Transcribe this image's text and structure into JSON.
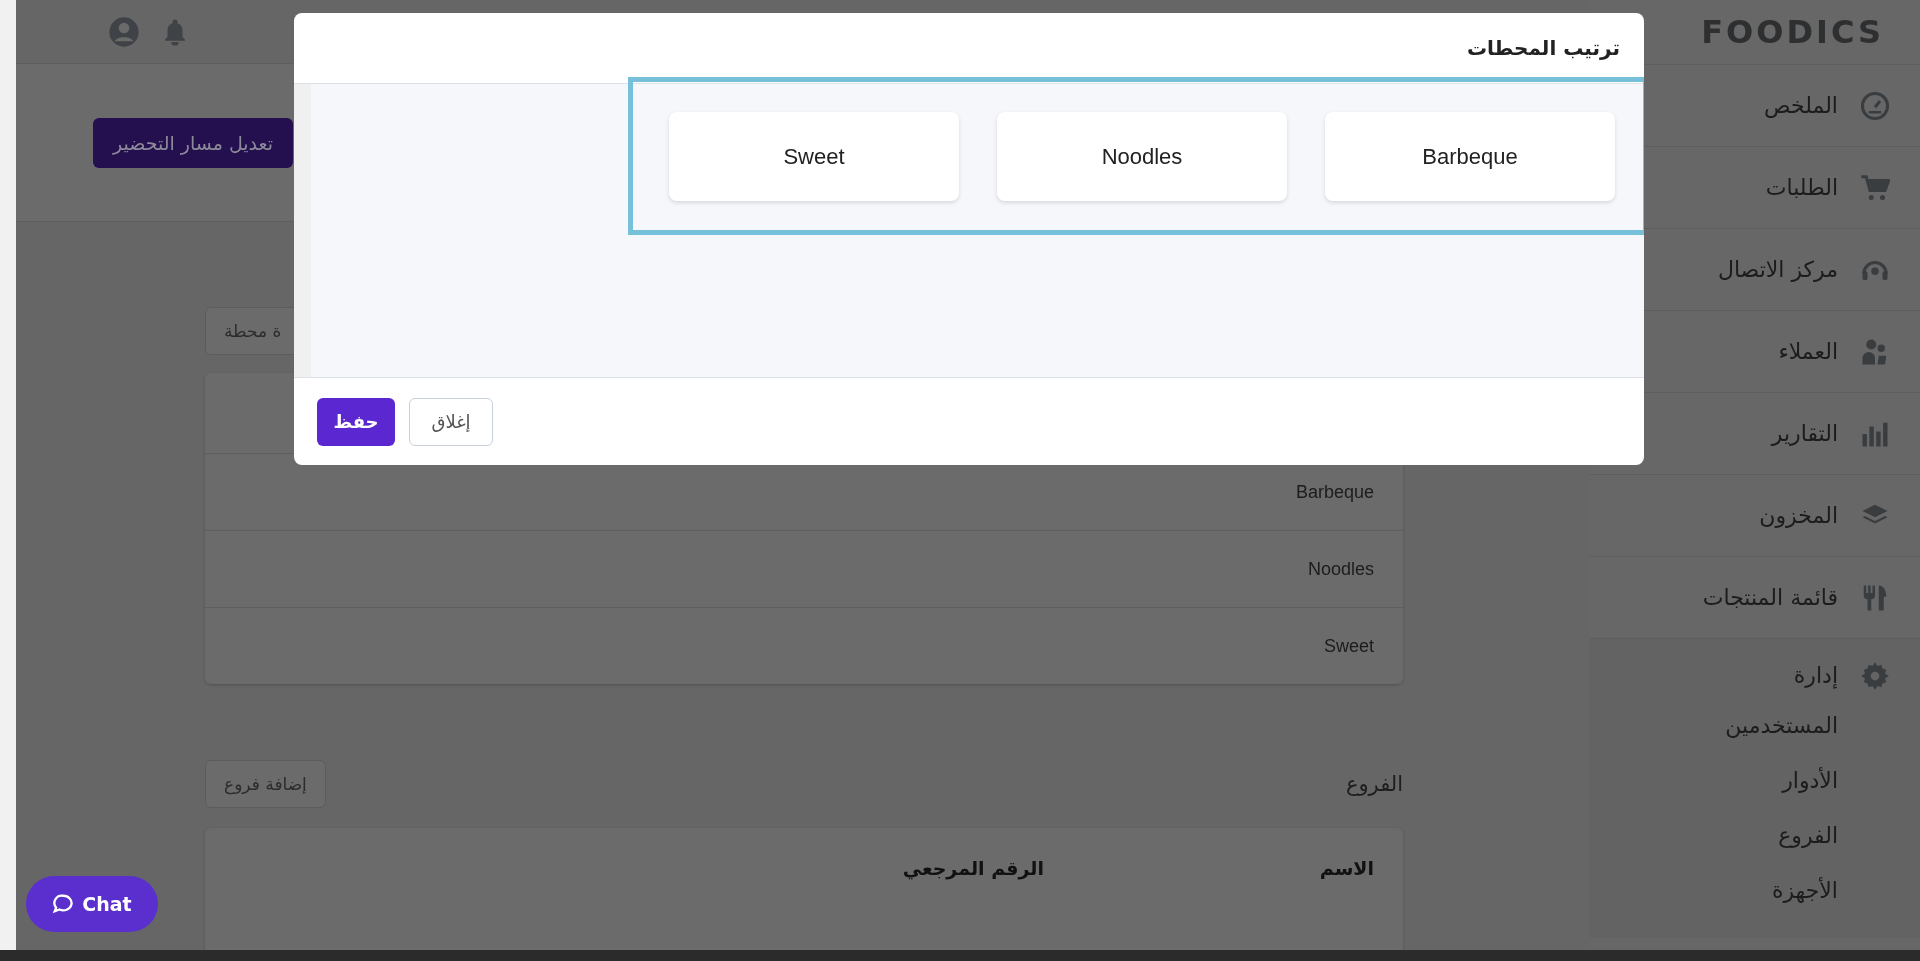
{
  "header": {
    "edit_button": "تعديل مسار التحضير"
  },
  "stations": {
    "add_button": "ة محطة",
    "rows": [
      "Barbeque",
      "Noodles",
      "Sweet"
    ]
  },
  "branches": {
    "title": "الفروع",
    "add_button": "إضافة فروع",
    "columns": [
      "الاسم",
      "الرقم المرجعي"
    ]
  },
  "sidebar": {
    "logo": "FOODICS",
    "items": [
      {
        "label": "الملخص"
      },
      {
        "label": "الطلبات"
      },
      {
        "label": "مركز الاتصال"
      },
      {
        "label": "العملاء"
      },
      {
        "label": "التقارير"
      },
      {
        "label": "المخزون"
      },
      {
        "label": "قائمة المنتجات"
      }
    ],
    "admin": {
      "label": "إدارة",
      "children": [
        "المستخدمين",
        "الأدوار",
        "الفروع",
        "الأجهزة"
      ]
    }
  },
  "modal": {
    "title": "ترتيب المحطات",
    "stations": [
      "Barbeque",
      "Noodles",
      "Sweet"
    ],
    "buttons": {
      "save": "حفظ",
      "close": "إغلاق"
    }
  },
  "chat": {
    "label": "Chat"
  }
}
